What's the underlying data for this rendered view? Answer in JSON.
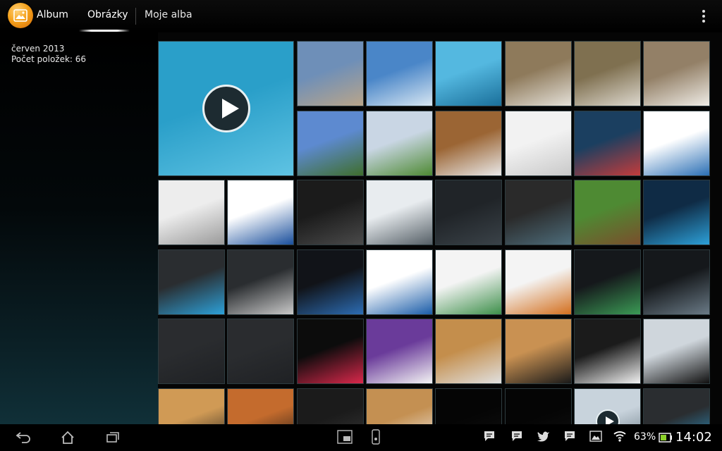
{
  "app": {
    "title": "Album"
  },
  "tabs": [
    {
      "label": "Obrázky",
      "selected": true
    },
    {
      "label": "Moje alba",
      "selected": false
    }
  ],
  "info": {
    "date": "červen 2013",
    "count_label": "Počet položek: 66"
  },
  "status": {
    "battery": "63%",
    "time": "14:02"
  },
  "thumbnails": [
    {
      "id": "video-pool",
      "kind": "video",
      "colors": [
        "#2a9fc9",
        "#5fc3e3"
      ]
    },
    {
      "id": "pergola",
      "colors": [
        "#6e8fb8",
        "#b9a58a"
      ]
    },
    {
      "id": "clouds",
      "colors": [
        "#4a86c8",
        "#d7e6f2"
      ]
    },
    {
      "id": "pool-blue",
      "colors": [
        "#54b8e0",
        "#1a6f9a"
      ]
    },
    {
      "id": "cat-1",
      "colors": [
        "#8e7a5b",
        "#e4e0d8"
      ]
    },
    {
      "id": "cat-2",
      "colors": [
        "#7f7050",
        "#ddd8ce"
      ]
    },
    {
      "id": "cat-3",
      "colors": [
        "#938067",
        "#efece6"
      ]
    },
    {
      "id": "garden-1",
      "colors": [
        "#5d8ad0",
        "#3f6e2c"
      ]
    },
    {
      "id": "garden-2",
      "colors": [
        "#c9d6e4",
        "#4e8a33"
      ]
    },
    {
      "id": "tablet-on-wood",
      "colors": [
        "#9b6534",
        "#e9e9e9"
      ]
    },
    {
      "id": "screenshot-ui-1",
      "colors": [
        "#f2f2f2",
        "#c9c9c9"
      ]
    },
    {
      "id": "screenshot-home-1",
      "colors": [
        "#1b3f60",
        "#c43c3c"
      ]
    },
    {
      "id": "screenshot-text-1",
      "colors": [
        "#ffffff",
        "#2b6fb5"
      ]
    },
    {
      "id": "screenshot-doc-1",
      "colors": [
        "#ededed",
        "#9a9a9a"
      ]
    },
    {
      "id": "screenshot-doc-2",
      "colors": [
        "#ffffff",
        "#1a4f9c"
      ]
    },
    {
      "id": "screenshot-calc",
      "colors": [
        "#1b1b1b",
        "#4a4a4a"
      ]
    },
    {
      "id": "screenshot-settings-1",
      "colors": [
        "#e8ecef",
        "#555f66"
      ]
    },
    {
      "id": "screenshot-dark-1",
      "colors": [
        "#202428",
        "#3a4248"
      ]
    },
    {
      "id": "screenshot-keypad",
      "colors": [
        "#2a2a2a",
        "#4d6c7a"
      ]
    },
    {
      "id": "gazebo",
      "colors": [
        "#4e8a33",
        "#7a4e2c"
      ]
    },
    {
      "id": "tv-show",
      "colors": [
        "#0f2b45",
        "#2da0d8"
      ]
    },
    {
      "id": "screenshot-settings-2",
      "colors": [
        "#2a2d30",
        "#2da0d8"
      ]
    },
    {
      "id": "screenshot-chart",
      "colors": [
        "#2a2d30",
        "#c9c9c9"
      ]
    },
    {
      "id": "screenshot-home-2",
      "colors": [
        "#111318",
        "#2c6cb3"
      ]
    },
    {
      "id": "screenshot-web-samsung",
      "colors": [
        "#ffffff",
        "#1a5ca8"
      ]
    },
    {
      "id": "screenshot-web-1",
      "colors": [
        "#f4f4f4",
        "#3d8f4a"
      ]
    },
    {
      "id": "screenshot-web-2",
      "colors": [
        "#f4f4f4",
        "#d36f1e"
      ]
    },
    {
      "id": "screenshot-code-1",
      "colors": [
        "#15181b",
        "#3b9a55"
      ]
    },
    {
      "id": "screenshot-code-2",
      "colors": [
        "#15181b",
        "#6a7a86"
      ]
    },
    {
      "id": "screenshot-dark-2",
      "colors": [
        "#2a2c2f",
        "#1f2124"
      ]
    },
    {
      "id": "screenshot-dark-3",
      "colors": [
        "#2a2c2f",
        "#1f2124"
      ]
    },
    {
      "id": "screenshot-clock",
      "colors": [
        "#0c0c0c",
        "#d9284b"
      ]
    },
    {
      "id": "screenshot-maps",
      "colors": [
        "#6a3b9a",
        "#f4f4f4"
      ]
    },
    {
      "id": "devices-1",
      "colors": [
        "#c48e4c",
        "#e0e0e0"
      ]
    },
    {
      "id": "devices-2",
      "colors": [
        "#c99152",
        "#1a1a1a"
      ]
    },
    {
      "id": "devices-3",
      "colors": [
        "#1b1b1b",
        "#f2f2f2"
      ]
    },
    {
      "id": "devices-4",
      "colors": [
        "#cfd6dc",
        "#111111"
      ]
    },
    {
      "id": "devices-5",
      "colors": [
        "#d09a55",
        "#1a1a1a"
      ]
    },
    {
      "id": "keyboard",
      "colors": [
        "#c46b2d",
        "#151515"
      ]
    },
    {
      "id": "tv-dark",
      "colors": [
        "#1b1b1b",
        "#3b3b3b"
      ]
    },
    {
      "id": "devices-6",
      "colors": [
        "#c49052",
        "#f2f2f2"
      ]
    },
    {
      "id": "black-1",
      "colors": [
        "#050505",
        "#121212"
      ]
    },
    {
      "id": "black-2",
      "colors": [
        "#050505",
        "#121212"
      ]
    },
    {
      "id": "video-sky",
      "kind": "video",
      "colors": [
        "#c8d3dc",
        "#5e6f7a"
      ]
    },
    {
      "id": "screenshot-home-3",
      "colors": [
        "#2a2d30",
        "#2da0d8"
      ]
    },
    {
      "id": "screenshot-dark-4",
      "colors": [
        "#1a1a1a",
        "#b02a2a"
      ]
    }
  ]
}
